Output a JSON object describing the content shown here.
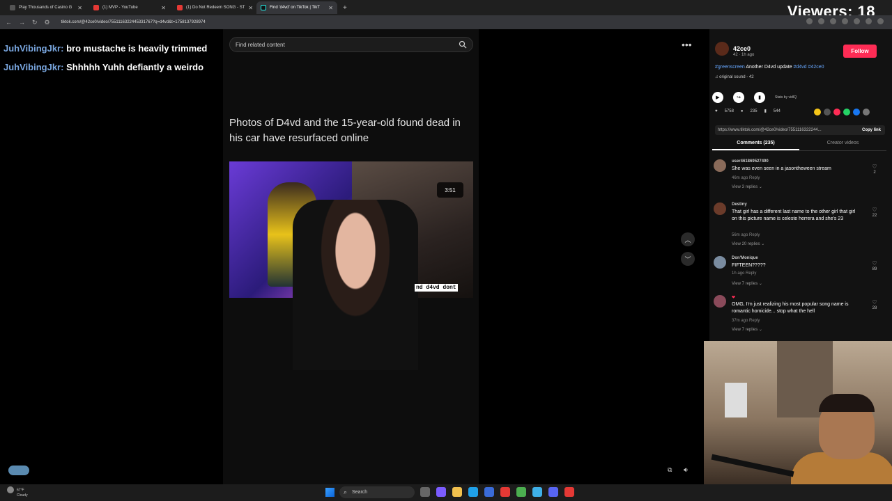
{
  "browser": {
    "tabs": [
      {
        "label": "Play Thousands of Casino G",
        "active": false
      },
      {
        "label": "(1) MVP - YouTube",
        "active": false
      },
      {
        "label": "(1) Do Not Redeem SONG - ST",
        "active": false
      },
      {
        "label": "Find 'd4vd' on TikTok | TikT",
        "active": true
      }
    ],
    "new_tab": "+",
    "url": "tiktok.com/@42ce0/video/7551116322445331767?q=d4vd&t=1758137928974"
  },
  "stream_overlay": {
    "viewers_label": "Viewers: 18",
    "chat": [
      {
        "user": "JuhVibingJkr:",
        "message": "bro mustache is heavily trimmed"
      },
      {
        "user": "JuhVibingJkr:",
        "message": "Shhhhh Yuhh defiantly a weirdo"
      }
    ]
  },
  "video": {
    "search_placeholder": "Find related content",
    "headline": "Photos of D4vd and the 15-year-old found dead in his car have resurfaced online",
    "time_badge": "3:51",
    "caption_text": "nd d4vd dont"
  },
  "post": {
    "username": "42ce0",
    "meta": "42 · 1h ago",
    "follow_label": "Follow",
    "desc_tag1": "#greenscreen",
    "desc_text": "Another D4vd update",
    "desc_tag2": "#d4vd",
    "desc_tag3": "#42ce0",
    "sound": "♫ original sound - 42",
    "stats_label": "Stats by vidIQ",
    "likes": "5758",
    "comments": "235",
    "saves": "544",
    "link": "https://www.tiktok.com/@42ce0/video/7551116322244...",
    "copy_label": "Copy link",
    "tab_comments": "Comments (235)",
    "tab_creator": "Creator videos"
  },
  "comments": [
    {
      "user": "user461869527490",
      "text": "She was even seen in a jasontheween stream",
      "meta": "46m ago   Reply",
      "replies": "View 3 replies ⌄",
      "likes": "2"
    },
    {
      "user": "Destiny",
      "text": "That girl has a different last name to the other girl that girl on this picture name is celeste herrera and she's 23",
      "meta": "56m ago   Reply",
      "replies": "View 20 replies ⌄",
      "likes": "22"
    },
    {
      "user": "Don'Monique",
      "text": "FIFTEEN?????",
      "meta": "1h ago   Reply",
      "replies": "View 7 replies ⌄",
      "likes": "89"
    },
    {
      "user": "❤",
      "text": "OMG, I'm just realizing his most popular song name is romantic homicide... stop what the hell",
      "meta": "37m ago   Reply",
      "replies": "View 7 replies ⌄",
      "likes": "28"
    }
  ],
  "taskbar": {
    "temp": "67°F",
    "weather": "Cloudy",
    "search_label": "Search"
  }
}
